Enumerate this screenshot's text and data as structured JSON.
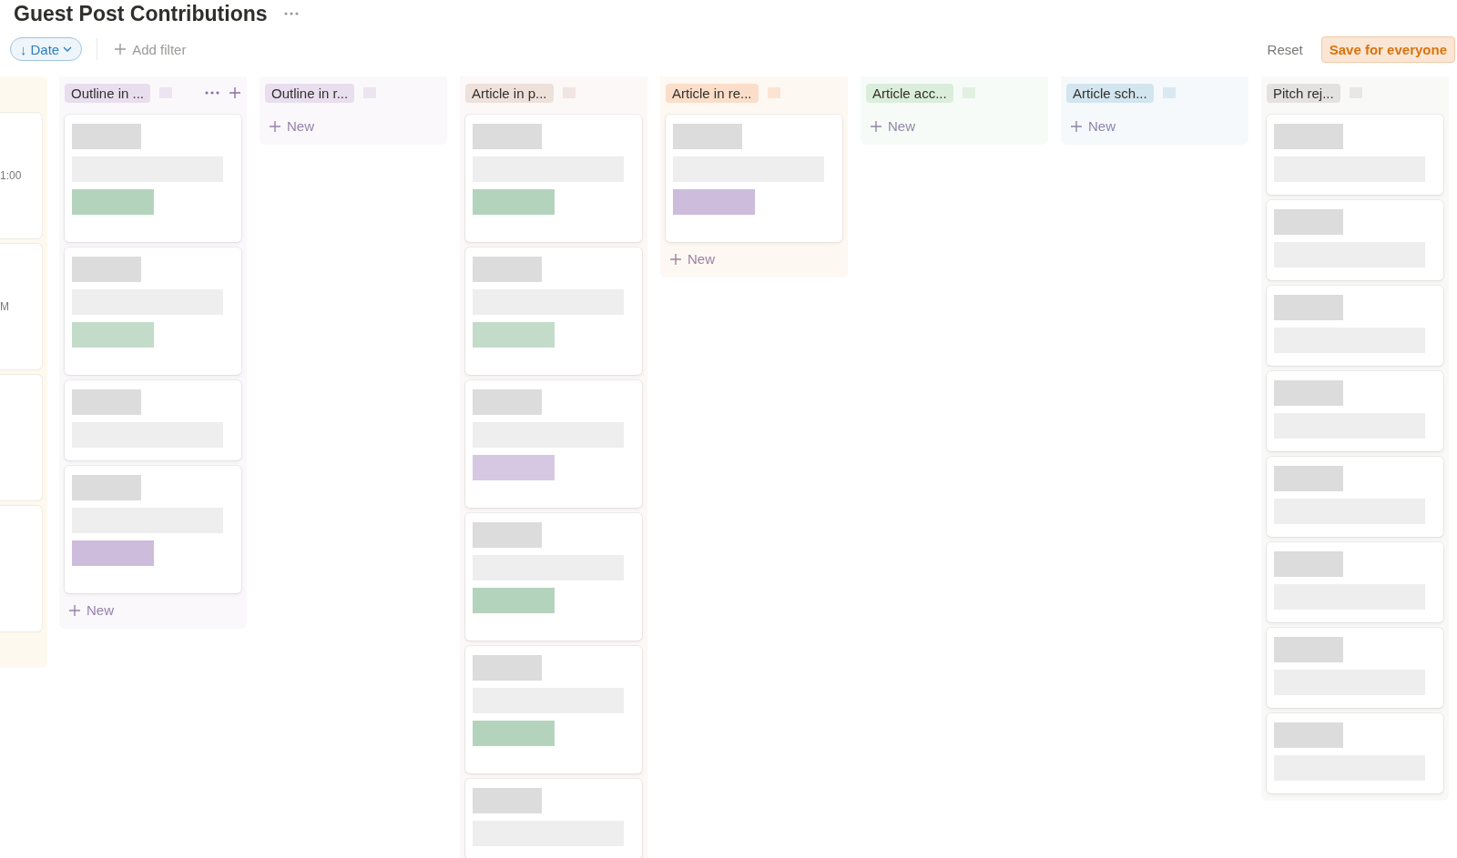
{
  "title": "Guest Post Contributions",
  "toolbar": {
    "sort": {
      "label": "Date",
      "arrow": "↓"
    },
    "add_filter": "Add filter",
    "reset": "Reset",
    "save": "Save for everyone"
  },
  "columns": [
    {
      "kind": "partial",
      "cards": [
        {
          "kind": "text",
          "snippet": "1:00"
        },
        {
          "kind": "text",
          "snippet": "M"
        },
        {
          "kind": "blank"
        },
        {
          "kind": "blank"
        }
      ]
    },
    {
      "kind": "full",
      "label": "Outline in ...",
      "color": "#e8deee",
      "hovered": true,
      "new_label": "New",
      "cards": [
        {
          "kind": "tagged",
          "color": "#b4d3bd"
        },
        {
          "kind": "tagged",
          "color": "#c3dcc9"
        },
        {
          "kind": "plain"
        },
        {
          "kind": "tagged",
          "color": "#cdbcdc"
        }
      ]
    },
    {
      "kind": "full",
      "label": "Outline in r...",
      "color": "#e8deee",
      "hovered": false,
      "new_label": "New"
    },
    {
      "kind": "full",
      "label": "Article in p...",
      "color": "#eee0da",
      "hovered": false,
      "cards": [
        {
          "kind": "tagged",
          "color": "#b4d3bd"
        },
        {
          "kind": "tagged",
          "color": "#c3dcc9"
        },
        {
          "kind": "tagged",
          "color": "#d6c8e2"
        },
        {
          "kind": "tagged",
          "color": "#b4d3bd"
        },
        {
          "kind": "tagged",
          "color": "#b4d3bd"
        },
        {
          "kind": "plain"
        }
      ]
    },
    {
      "kind": "full",
      "label": "Article in re...",
      "color": "#fadec9",
      "hovered": false,
      "new_label": "New",
      "cards": [
        {
          "kind": "tagged",
          "color": "#cdbcdc"
        }
      ]
    },
    {
      "kind": "full",
      "label": "Article acc...",
      "color": "#dbeddb",
      "hovered": false,
      "new_label": "New"
    },
    {
      "kind": "full",
      "label": "Article sch...",
      "color": "#d3e5ef",
      "hovered": false,
      "new_label": "New"
    },
    {
      "kind": "full",
      "label": "Pitch rej...",
      "color": "#e3e2e0",
      "hovered": false,
      "cards": [
        {
          "kind": "plain"
        },
        {
          "kind": "plain"
        },
        {
          "kind": "plain"
        },
        {
          "kind": "plain"
        },
        {
          "kind": "plain"
        },
        {
          "kind": "plain"
        },
        {
          "kind": "plain"
        },
        {
          "kind": "plain"
        }
      ]
    }
  ]
}
